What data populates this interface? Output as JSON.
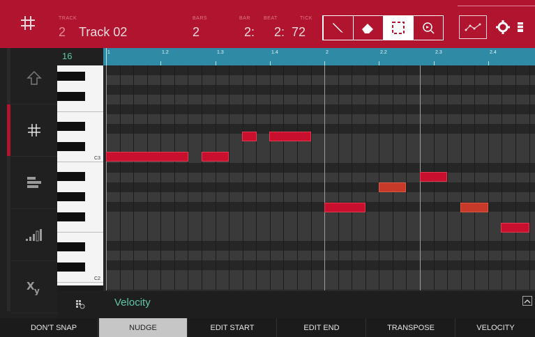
{
  "header": {
    "track_label": "TRACK",
    "track_number": "2",
    "track_name": "Track 02",
    "bars_label": "BARS",
    "bars_value": "2",
    "bar_label": "BAR",
    "bar_value": "2:",
    "beat_label": "BEAT",
    "beat_value": "2:",
    "tick_label": "TICK",
    "tick_value": "72"
  },
  "tools": [
    "pencil-icon",
    "eraser-icon",
    "select-icon",
    "zoom-icon"
  ],
  "sidebar": {
    "items": [
      {
        "name": "arrow-up-icon"
      },
      {
        "name": "grid-icon"
      },
      {
        "name": "list-icon"
      },
      {
        "name": "velocity-icon"
      },
      {
        "name": "xy-icon"
      }
    ]
  },
  "keyboard": {
    "top_value": "16",
    "c3_label": "C3",
    "c2_label": "C2"
  },
  "ruler": {
    "labels": [
      "1",
      "1.2",
      "1.3",
      "1.4",
      "2",
      "2.2",
      "2.3",
      "2.4"
    ]
  },
  "velocity": {
    "label": "Velocity"
  },
  "footer": {
    "buttons": [
      "DON'T SNAP",
      "NUDGE",
      "EDIT START",
      "EDIT END",
      "TRANSPOSE",
      "VELOCITY"
    ]
  },
  "colors": {
    "accent": "#b0142e",
    "note": "#c8102e",
    "ruler": "#2f8aa5",
    "velocity_text": "#5fc8a8"
  }
}
